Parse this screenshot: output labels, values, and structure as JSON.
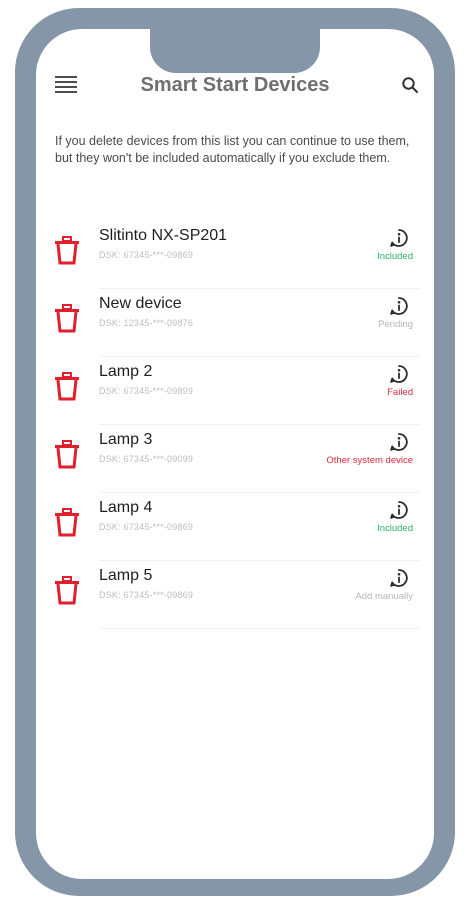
{
  "header": {
    "title": "Smart Start Devices"
  },
  "intro": {
    "text": "If you delete devices from this list you can continue to use them, but they won't be included automatically if you exclude them."
  },
  "devices": [
    {
      "name": "Slitinto NX-SP201",
      "dsk": "DSK: 67345-***-09869",
      "status": "Included",
      "status_color": "#2fae62"
    },
    {
      "name": "New device",
      "dsk": "DSK: 12345-***-09876",
      "status": "Pending",
      "status_color": "#b5b5b5"
    },
    {
      "name": "Lamp 2",
      "dsk": "DSK: 67345-***-09899",
      "status": "Failed",
      "status_color": "#d62b3c"
    },
    {
      "name": "Lamp 3",
      "dsk": "DSK: 67345-***-09099",
      "status": "Other system device",
      "status_color": "#d62b3c"
    },
    {
      "name": "Lamp 4",
      "dsk": "DSK: 67345-***-09869",
      "status": "Included",
      "status_color": "#2fae62"
    },
    {
      "name": "Lamp 5",
      "dsk": "DSK: 67345-***-09869",
      "status": "Add manually",
      "status_color": "#b5b5b5"
    }
  ],
  "colors": {
    "frame": "#8696a9",
    "trash": "#e0202d"
  },
  "icons": {
    "menu": "hamburger-icon",
    "search": "search-icon",
    "delete": "trash-icon",
    "info": "info-icon"
  }
}
